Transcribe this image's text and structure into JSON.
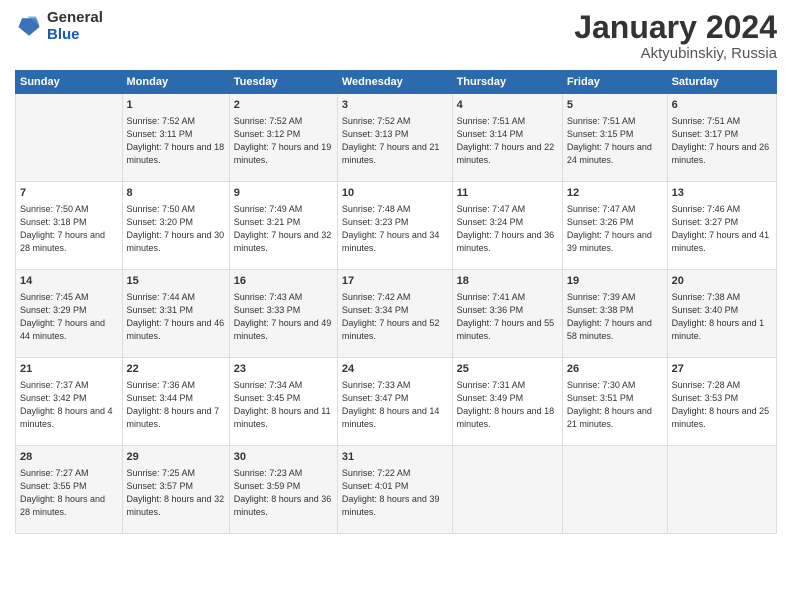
{
  "logo": {
    "general": "General",
    "blue": "Blue"
  },
  "title": {
    "month": "January 2024",
    "location": "Aktyubinskiy, Russia"
  },
  "headers": [
    "Sunday",
    "Monday",
    "Tuesday",
    "Wednesday",
    "Thursday",
    "Friday",
    "Saturday"
  ],
  "weeks": [
    [
      {
        "day": "",
        "sunrise": "",
        "sunset": "",
        "daylight": ""
      },
      {
        "day": "1",
        "sunrise": "Sunrise: 7:52 AM",
        "sunset": "Sunset: 3:11 PM",
        "daylight": "Daylight: 7 hours and 18 minutes."
      },
      {
        "day": "2",
        "sunrise": "Sunrise: 7:52 AM",
        "sunset": "Sunset: 3:12 PM",
        "daylight": "Daylight: 7 hours and 19 minutes."
      },
      {
        "day": "3",
        "sunrise": "Sunrise: 7:52 AM",
        "sunset": "Sunset: 3:13 PM",
        "daylight": "Daylight: 7 hours and 21 minutes."
      },
      {
        "day": "4",
        "sunrise": "Sunrise: 7:51 AM",
        "sunset": "Sunset: 3:14 PM",
        "daylight": "Daylight: 7 hours and 22 minutes."
      },
      {
        "day": "5",
        "sunrise": "Sunrise: 7:51 AM",
        "sunset": "Sunset: 3:15 PM",
        "daylight": "Daylight: 7 hours and 24 minutes."
      },
      {
        "day": "6",
        "sunrise": "Sunrise: 7:51 AM",
        "sunset": "Sunset: 3:17 PM",
        "daylight": "Daylight: 7 hours and 26 minutes."
      }
    ],
    [
      {
        "day": "7",
        "sunrise": "Sunrise: 7:50 AM",
        "sunset": "Sunset: 3:18 PM",
        "daylight": "Daylight: 7 hours and 28 minutes."
      },
      {
        "day": "8",
        "sunrise": "Sunrise: 7:50 AM",
        "sunset": "Sunset: 3:20 PM",
        "daylight": "Daylight: 7 hours and 30 minutes."
      },
      {
        "day": "9",
        "sunrise": "Sunrise: 7:49 AM",
        "sunset": "Sunset: 3:21 PM",
        "daylight": "Daylight: 7 hours and 32 minutes."
      },
      {
        "day": "10",
        "sunrise": "Sunrise: 7:48 AM",
        "sunset": "Sunset: 3:23 PM",
        "daylight": "Daylight: 7 hours and 34 minutes."
      },
      {
        "day": "11",
        "sunrise": "Sunrise: 7:47 AM",
        "sunset": "Sunset: 3:24 PM",
        "daylight": "Daylight: 7 hours and 36 minutes."
      },
      {
        "day": "12",
        "sunrise": "Sunrise: 7:47 AM",
        "sunset": "Sunset: 3:26 PM",
        "daylight": "Daylight: 7 hours and 39 minutes."
      },
      {
        "day": "13",
        "sunrise": "Sunrise: 7:46 AM",
        "sunset": "Sunset: 3:27 PM",
        "daylight": "Daylight: 7 hours and 41 minutes."
      }
    ],
    [
      {
        "day": "14",
        "sunrise": "Sunrise: 7:45 AM",
        "sunset": "Sunset: 3:29 PM",
        "daylight": "Daylight: 7 hours and 44 minutes."
      },
      {
        "day": "15",
        "sunrise": "Sunrise: 7:44 AM",
        "sunset": "Sunset: 3:31 PM",
        "daylight": "Daylight: 7 hours and 46 minutes."
      },
      {
        "day": "16",
        "sunrise": "Sunrise: 7:43 AM",
        "sunset": "Sunset: 3:33 PM",
        "daylight": "Daylight: 7 hours and 49 minutes."
      },
      {
        "day": "17",
        "sunrise": "Sunrise: 7:42 AM",
        "sunset": "Sunset: 3:34 PM",
        "daylight": "Daylight: 7 hours and 52 minutes."
      },
      {
        "day": "18",
        "sunrise": "Sunrise: 7:41 AM",
        "sunset": "Sunset: 3:36 PM",
        "daylight": "Daylight: 7 hours and 55 minutes."
      },
      {
        "day": "19",
        "sunrise": "Sunrise: 7:39 AM",
        "sunset": "Sunset: 3:38 PM",
        "daylight": "Daylight: 7 hours and 58 minutes."
      },
      {
        "day": "20",
        "sunrise": "Sunrise: 7:38 AM",
        "sunset": "Sunset: 3:40 PM",
        "daylight": "Daylight: 8 hours and 1 minute."
      }
    ],
    [
      {
        "day": "21",
        "sunrise": "Sunrise: 7:37 AM",
        "sunset": "Sunset: 3:42 PM",
        "daylight": "Daylight: 8 hours and 4 minutes."
      },
      {
        "day": "22",
        "sunrise": "Sunrise: 7:36 AM",
        "sunset": "Sunset: 3:44 PM",
        "daylight": "Daylight: 8 hours and 7 minutes."
      },
      {
        "day": "23",
        "sunrise": "Sunrise: 7:34 AM",
        "sunset": "Sunset: 3:45 PM",
        "daylight": "Daylight: 8 hours and 11 minutes."
      },
      {
        "day": "24",
        "sunrise": "Sunrise: 7:33 AM",
        "sunset": "Sunset: 3:47 PM",
        "daylight": "Daylight: 8 hours and 14 minutes."
      },
      {
        "day": "25",
        "sunrise": "Sunrise: 7:31 AM",
        "sunset": "Sunset: 3:49 PM",
        "daylight": "Daylight: 8 hours and 18 minutes."
      },
      {
        "day": "26",
        "sunrise": "Sunrise: 7:30 AM",
        "sunset": "Sunset: 3:51 PM",
        "daylight": "Daylight: 8 hours and 21 minutes."
      },
      {
        "day": "27",
        "sunrise": "Sunrise: 7:28 AM",
        "sunset": "Sunset: 3:53 PM",
        "daylight": "Daylight: 8 hours and 25 minutes."
      }
    ],
    [
      {
        "day": "28",
        "sunrise": "Sunrise: 7:27 AM",
        "sunset": "Sunset: 3:55 PM",
        "daylight": "Daylight: 8 hours and 28 minutes."
      },
      {
        "day": "29",
        "sunrise": "Sunrise: 7:25 AM",
        "sunset": "Sunset: 3:57 PM",
        "daylight": "Daylight: 8 hours and 32 minutes."
      },
      {
        "day": "30",
        "sunrise": "Sunrise: 7:23 AM",
        "sunset": "Sunset: 3:59 PM",
        "daylight": "Daylight: 8 hours and 36 minutes."
      },
      {
        "day": "31",
        "sunrise": "Sunrise: 7:22 AM",
        "sunset": "Sunset: 4:01 PM",
        "daylight": "Daylight: 8 hours and 39 minutes."
      },
      {
        "day": "",
        "sunrise": "",
        "sunset": "",
        "daylight": ""
      },
      {
        "day": "",
        "sunrise": "",
        "sunset": "",
        "daylight": ""
      },
      {
        "day": "",
        "sunrise": "",
        "sunset": "",
        "daylight": ""
      }
    ]
  ]
}
